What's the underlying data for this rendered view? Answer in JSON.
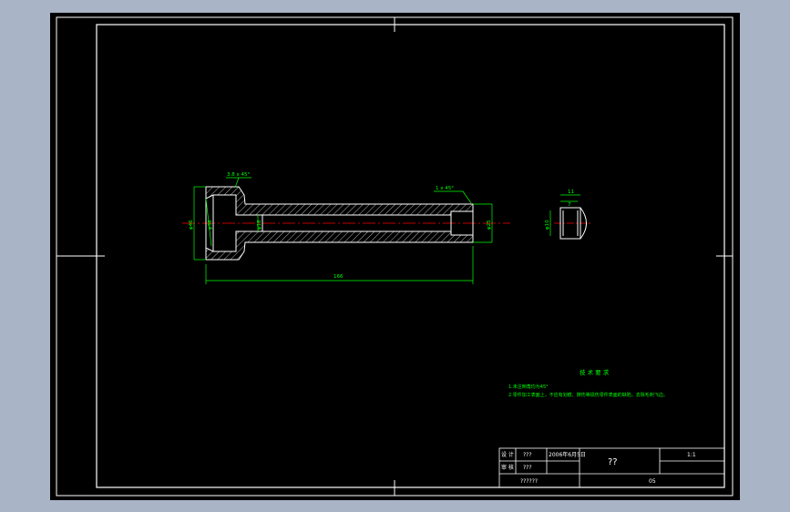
{
  "drawing": {
    "dimensions": {
      "chamfer_head": "3.8 x 45°",
      "chamfer_end": "1 x 45°",
      "dia_head_outer": "φ46",
      "dia_head_inner": "φ38",
      "dia_shaft": "φ18",
      "dia_bore": "φ25",
      "overall_length": "166",
      "side_top": "11",
      "side_mid": "7",
      "side_dia": "φ10"
    },
    "notes": {
      "title": "技 术 要 求",
      "line1": "1.未注倒角均为45°",
      "line2": "2.零件加工表面上，不应有划痕、擦伤等损伤零件表面的缺陷，去除毛刺飞边。"
    },
    "title_block": {
      "row1_label": "设 计",
      "row1_name": "???",
      "row1_date": "2006年6月5日",
      "row2_label": "审 核",
      "row2_name": "???",
      "part_name": "??",
      "scale": "1:1",
      "school": "??????",
      "drawing_no": "05"
    }
  },
  "colors": {
    "background": "#000000",
    "frame": "#ffffff",
    "dimension": "#00ff00",
    "centerline": "#ff0000",
    "hatch": "#ffffff",
    "outside": "#a9b4c6"
  }
}
